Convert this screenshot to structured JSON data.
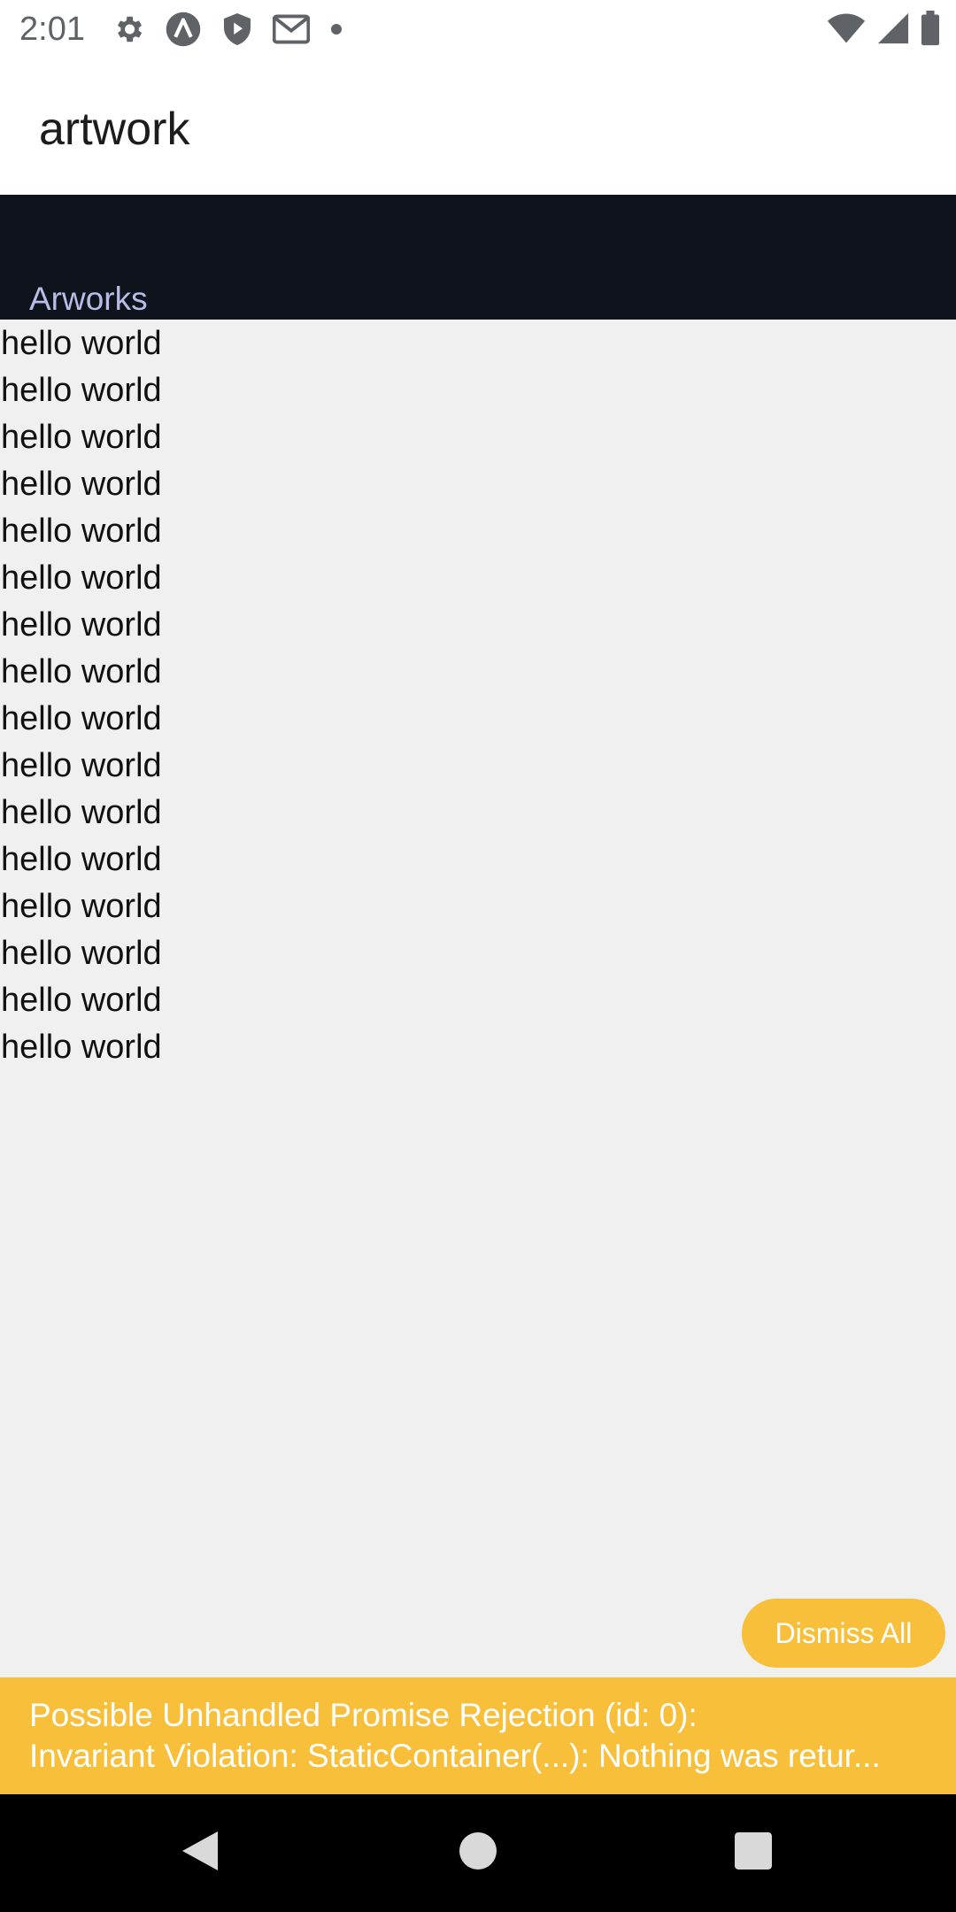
{
  "status_bar": {
    "time": "2:01",
    "left_icons": [
      "gear-icon",
      "app-icon",
      "shield-icon",
      "gmail-icon",
      "dot-icon"
    ],
    "right_icons": [
      "wifi-icon",
      "signal-icon",
      "battery-icon"
    ]
  },
  "app_bar": {
    "title": "artwork"
  },
  "header": {
    "label": "Arworks"
  },
  "list": {
    "items": [
      "hello world",
      "hello world",
      "hello world",
      "hello world",
      "hello world",
      "hello world",
      "hello world",
      "hello world",
      "hello world",
      "hello world",
      "hello world",
      "hello world",
      "hello world",
      "hello world",
      "hello world",
      "hello world"
    ]
  },
  "warning": {
    "dismiss_label": "Dismiss All",
    "line1": "Possible Unhandled Promise Rejection (id: 0):",
    "line2": "Invariant Violation: StaticContainer(...): Nothing was retur..."
  },
  "nav": {
    "icons": [
      "back-icon",
      "home-icon",
      "recents-icon"
    ]
  },
  "colors": {
    "header_bg": "#0f141c",
    "header_text": "#b8bde6",
    "warning_bg": "#f8bf3a"
  }
}
